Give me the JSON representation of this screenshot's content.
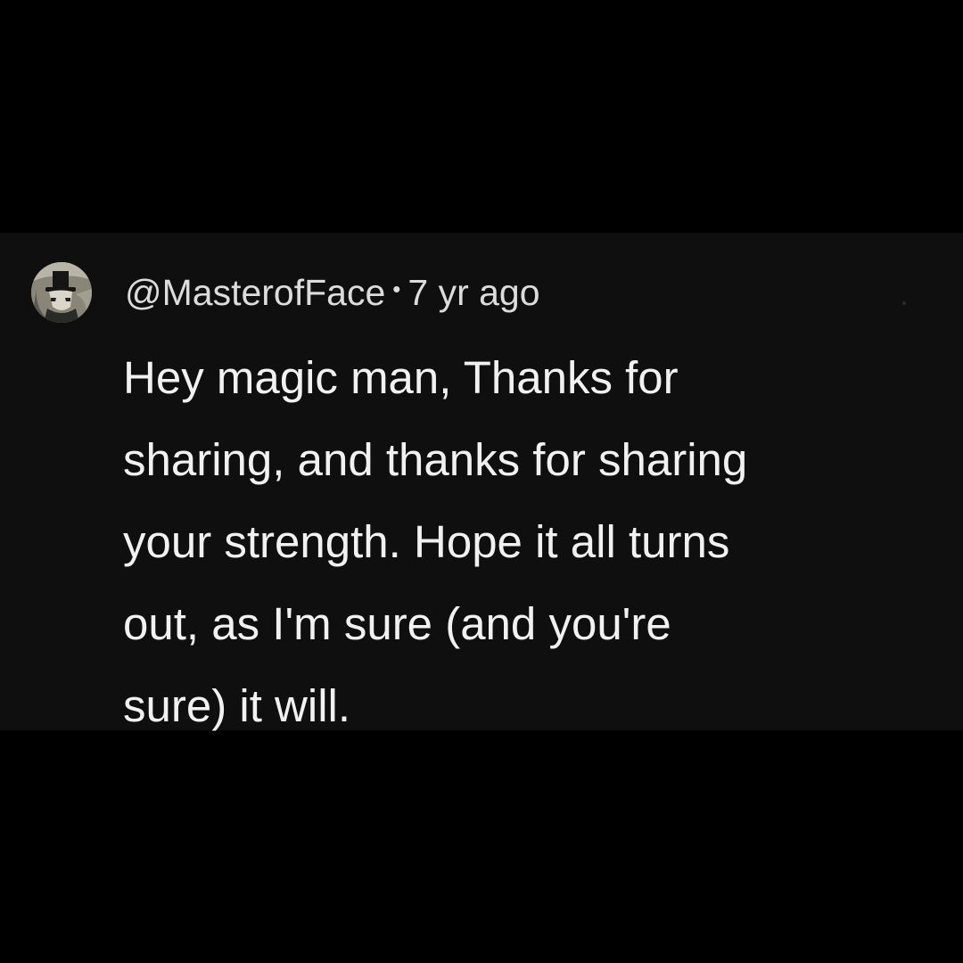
{
  "comment": {
    "handle": "@MasterofFace",
    "separator": "•",
    "timestamp": "7 yr ago",
    "avatar_icon": "top-hat-magician-avatar-icon",
    "body_lines": [
      "Hey magic man, Thanks for",
      "sharing, and thanks for sharing",
      "your strength. Hope it all turns",
      "out, as I'm sure (and you're",
      "sure) it will."
    ]
  },
  "colors": {
    "page_background": "#000000",
    "card_background": "#0f0f0f",
    "meta_text": "#dcdcdc",
    "body_text": "#f1f1f1"
  }
}
